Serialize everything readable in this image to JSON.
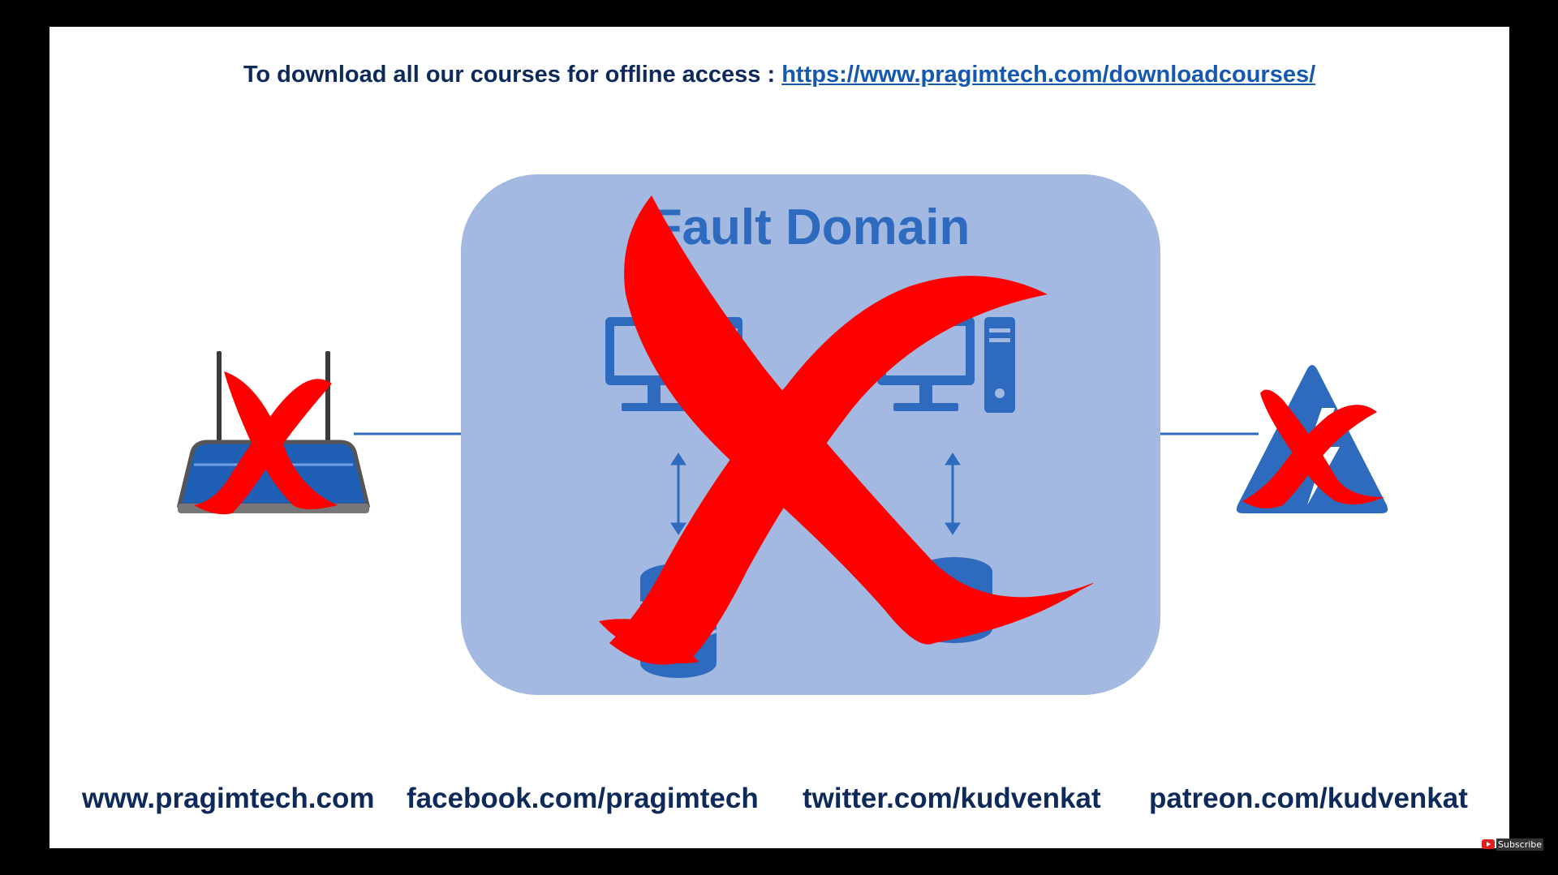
{
  "slide": {
    "download_text": "To download all our courses for offline access : ",
    "download_link": "https://www.pragimtech.com/downloadcourses/",
    "diagram_title": "Fault Domain",
    "footer": {
      "website": "www.pragimtech.com",
      "facebook": "facebook.com/pragimtech",
      "twitter": "twitter.com/kudvenkat",
      "patreon": "patreon.com/kudvenkat"
    }
  },
  "overlay": {
    "subscribe_label": "Subscribe"
  },
  "colors": {
    "domain_box": "#a3b9e2",
    "icon_blue": "#2e6bbf",
    "text_dark": "#0d2a5a",
    "link_blue": "#1558b0",
    "cross_red": "#ff0000"
  },
  "icons": [
    "router-icon",
    "computer-icon",
    "server-icon",
    "database-icon",
    "power-warning-icon",
    "cross-out-mark"
  ]
}
